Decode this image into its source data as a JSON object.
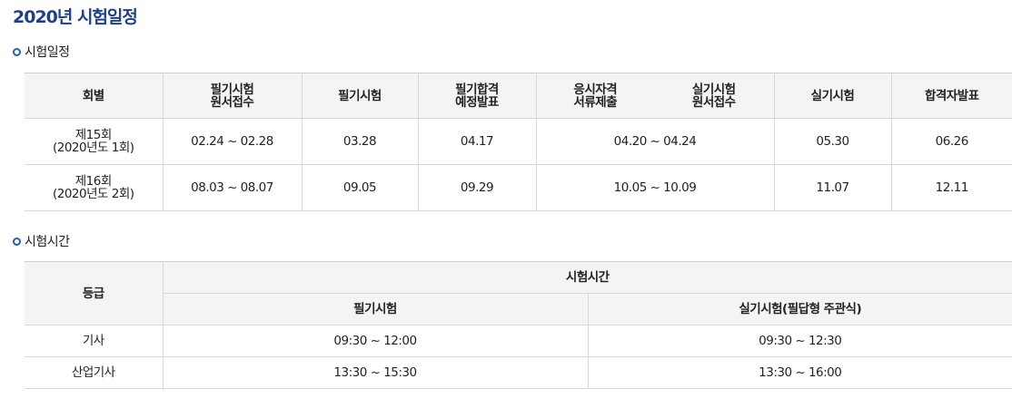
{
  "page_title": "2020년 시험일정",
  "sections": {
    "schedule_title": "시험일정",
    "time_title": "시험시간"
  },
  "schedule": {
    "headers": {
      "round": "회별",
      "written_app": [
        "필기시험",
        "원서접수"
      ],
      "written_exam": "필기시험",
      "written_pass": [
        "필기합격",
        "예정발표"
      ],
      "qualification": [
        "응시자격",
        "서류제출"
      ],
      "practical_app": [
        "실기시험",
        "원서접수"
      ],
      "practical_exam": "실기시험",
      "final_pass": "합격자발표"
    },
    "rows": [
      {
        "round": [
          "제15회",
          "(2020년도 1회)"
        ],
        "written_app": "02.24 ~ 02.28",
        "written_exam": "03.28",
        "written_pass": "04.17",
        "qual_practical_app": "04.20 ~ 04.24",
        "practical_exam": "05.30",
        "final_pass": "06.26"
      },
      {
        "round": [
          "제16회",
          "(2020년도 2회)"
        ],
        "written_app": "08.03 ~ 08.07",
        "written_exam": "09.05",
        "written_pass": "09.29",
        "qual_practical_app": "10.05 ~ 10.09",
        "practical_exam": "11.07",
        "final_pass": "12.11"
      }
    ]
  },
  "exam_time": {
    "headers": {
      "grade": "등급",
      "time": "시험시간",
      "written": "필기시험",
      "practical": "실기시험(필답형 주관식)"
    },
    "rows": [
      {
        "grade": "기사",
        "written": "09:30 ~ 12:00",
        "practical": "09:30 ~ 12:30"
      },
      {
        "grade": "산업기사",
        "written": "13:30 ~ 15:30",
        "practical": "13:30 ~ 16:00"
      }
    ]
  },
  "colors": {
    "title": "#1f3f8f",
    "bullet": "#1f5fbf",
    "header_bg": "#f4f4f4",
    "border": "#d8d8d8"
  }
}
